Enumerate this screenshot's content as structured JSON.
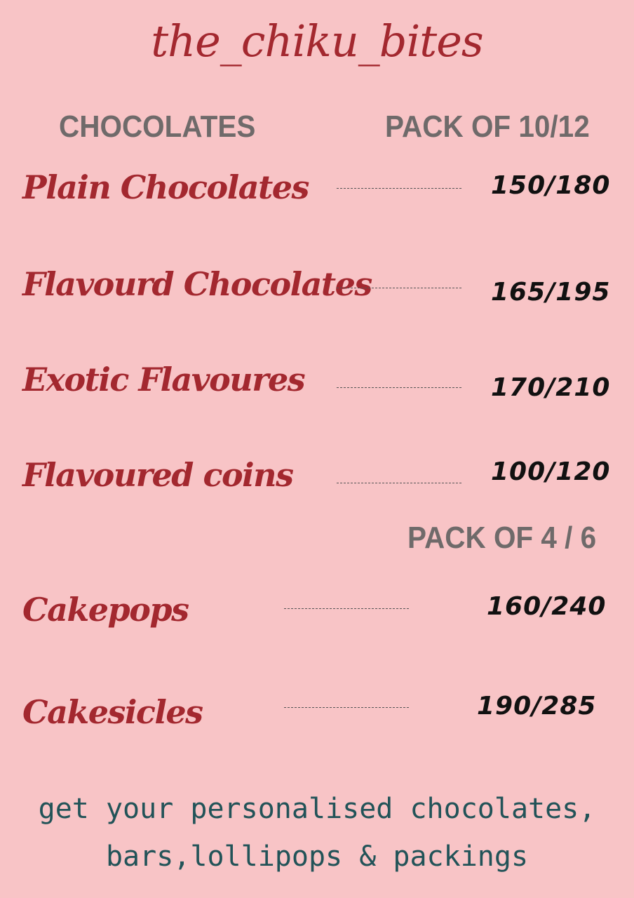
{
  "brand": "the_chiku_bites",
  "headers": {
    "category": "CHOCOLATES",
    "pack1": "PACK OF 10/12",
    "pack2": "PACK OF  4 / 6"
  },
  "items": [
    {
      "name": "Plain Chocolates",
      "price": "150/180"
    },
    {
      "name": "Flavourd Chocolates",
      "price": "165/195"
    },
    {
      "name": "Exotic Flavoures",
      "price": "170/210"
    },
    {
      "name": "Flavoured coins",
      "price": "100/120"
    },
    {
      "name": "Cakepops",
      "price": "160/240"
    },
    {
      "name": "Cakesicles",
      "price": "190/285"
    }
  ],
  "footer": {
    "line1": "get your personalised chocolates,",
    "line2": "bars,lollipops & packings"
  },
  "colors": {
    "background": "#f8c4c6",
    "item_red": "#a3282f",
    "header_gray": "#6f6a6a",
    "footer_teal": "#225358"
  }
}
